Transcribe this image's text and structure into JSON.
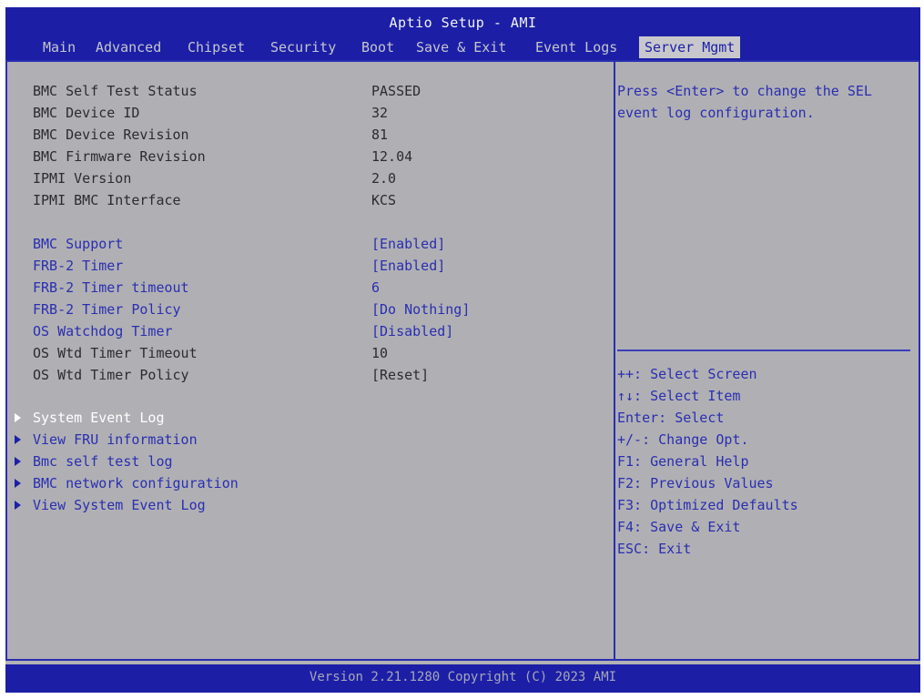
{
  "app": {
    "title": "Aptio Setup - AMI"
  },
  "tabs": [
    {
      "label": "Main"
    },
    {
      "label": "Advanced"
    },
    {
      "label": "Chipset"
    },
    {
      "label": "Security"
    },
    {
      "label": "Boot"
    },
    {
      "label": "Save & Exit"
    },
    {
      "label": "Event Logs"
    },
    {
      "label": "Server Mgmt",
      "active": true
    }
  ],
  "info": [
    {
      "label": "BMC Self Test Status",
      "value": "PASSED"
    },
    {
      "label": "BMC Device ID",
      "value": "32"
    },
    {
      "label": "BMC Device Revision",
      "value": "81"
    },
    {
      "label": "BMC Firmware Revision",
      "value": "12.04"
    },
    {
      "label": "IPMI Version",
      "value": "2.0"
    },
    {
      "label": "IPMI BMC Interface",
      "value": "KCS"
    }
  ],
  "settings": [
    {
      "label": "BMC Support",
      "value": "[Enabled]"
    },
    {
      "label": "FRB-2 Timer",
      "value": "[Enabled]"
    },
    {
      "label": "FRB-2 Timer timeout",
      "value": "6"
    },
    {
      "label": "FRB-2 Timer Policy",
      "value": "[Do Nothing]"
    },
    {
      "label": "OS Watchdog Timer",
      "value": "[Disabled]"
    },
    {
      "label": "OS Wtd Timer Timeout",
      "value": "10"
    },
    {
      "label": "OS Wtd Timer Policy",
      "value": "[Reset]"
    }
  ],
  "submenus": [
    {
      "label": "System Event Log",
      "selected": true
    },
    {
      "label": "View FRU information"
    },
    {
      "label": "Bmc self test log"
    },
    {
      "label": "BMC network configuration"
    },
    {
      "label": "View System Event Log"
    }
  ],
  "help": {
    "text": "Press <Enter> to change the SEL event log configuration."
  },
  "keys": [
    "++: Select Screen",
    "↑↓: Select Item",
    "Enter: Select",
    "+/-: Change Opt.",
    "F1: General Help",
    "F2: Previous Values",
    "F3: Optimized Defaults",
    "F4: Save & Exit",
    "ESC: Exit"
  ],
  "footer": {
    "text": "Version 2.21.1280 Copyright (C) 2023 AMI"
  },
  "colors": {
    "header_blue": "#1c1fa6",
    "panel_gray": "#b0b0b4",
    "text_blue": "#2a2eb0",
    "text_dark": "#2c2c30",
    "selected_white": "#ffffff"
  }
}
